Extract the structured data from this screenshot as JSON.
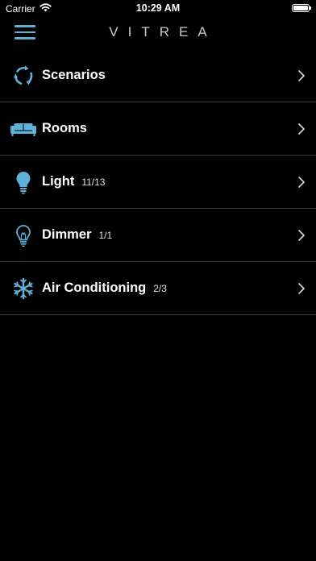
{
  "status_bar": {
    "carrier": "Carrier",
    "time": "10:29 AM",
    "wifi_icon": "wifi-icon",
    "battery_icon": "battery-icon"
  },
  "nav": {
    "menu_icon": "hamburger-menu-icon",
    "logo": "VITREA"
  },
  "colors": {
    "accent": "#5fb1d8",
    "background": "#000000",
    "divider": "#3a3a3a",
    "text": "#ffffff"
  },
  "menu": {
    "items": [
      {
        "label": "Scenarios",
        "count": "",
        "icon": "scenarios-refresh-icon"
      },
      {
        "label": "Rooms",
        "count": "",
        "icon": "sofa-icon"
      },
      {
        "label": "Light",
        "count": "11/13",
        "icon": "lightbulb-icon"
      },
      {
        "label": "Dimmer",
        "count": "1/1",
        "icon": "dimmer-bulb-icon"
      },
      {
        "label": "Air Conditioning",
        "count": "2/3",
        "icon": "snowflake-icon"
      }
    ]
  }
}
